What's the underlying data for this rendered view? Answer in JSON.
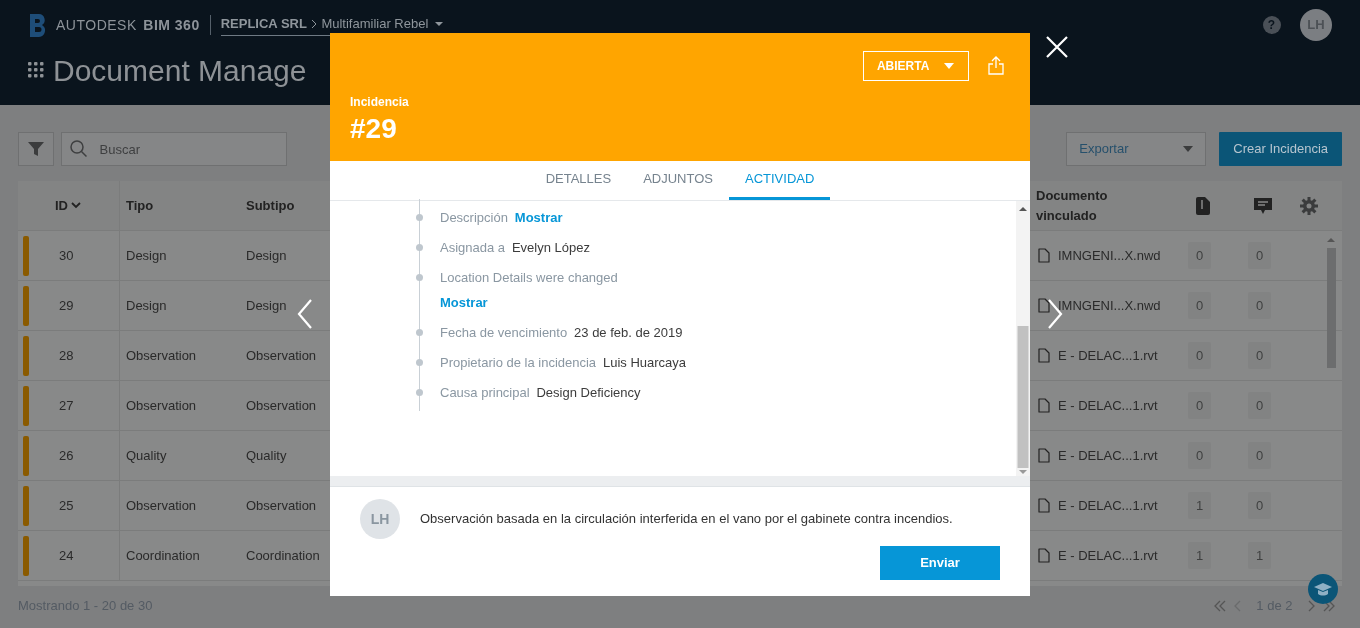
{
  "header": {
    "brand": "AUTODESK",
    "product": "BIM 360",
    "account": "REPLICA SRL",
    "project": "Multifamiliar Rebel",
    "help": "?",
    "avatar": "LH"
  },
  "page_title": "Document Manage",
  "toolbar": {
    "search": {
      "placeholder": "Buscar"
    },
    "export": "Exportar",
    "create": "Crear Incidencia"
  },
  "table": {
    "columns": [
      {
        "label": "ID",
        "kind": "id"
      },
      {
        "label": "Tipo",
        "kind": "text"
      },
      {
        "label": "Subtipo",
        "kind": "text"
      },
      {
        "label": "Documento vinculado",
        "kind": "text"
      },
      {
        "kind": "attachments"
      },
      {
        "kind": "comments"
      },
      {
        "kind": "settings"
      }
    ],
    "rows": [
      {
        "id": "30",
        "tipo": "Design",
        "subtipo": "Design",
        "document": "IMNGENI...X.nwd",
        "attachments": "0",
        "comments": "0"
      },
      {
        "id": "29",
        "tipo": "Design",
        "subtipo": "Design",
        "document": "IMNGENI...X.nwd",
        "attachments": "0",
        "comments": "0"
      },
      {
        "id": "28",
        "tipo": "Observation",
        "subtipo": "Observation",
        "document": "E - DELAC...1.rvt",
        "attachments": "0",
        "comments": "0"
      },
      {
        "id": "27",
        "tipo": "Observation",
        "subtipo": "Observation",
        "document": "E - DELAC...1.rvt",
        "attachments": "0",
        "comments": "0"
      },
      {
        "id": "26",
        "tipo": "Quality",
        "subtipo": "Quality",
        "document": "E - DELAC...1.rvt",
        "attachments": "0",
        "comments": "0"
      },
      {
        "id": "25",
        "tipo": "Observation",
        "subtipo": "Observation",
        "document": "E - DELAC...1.rvt",
        "attachments": "1",
        "comments": "0"
      },
      {
        "id": "24",
        "tipo": "Coordination",
        "subtipo": "Coordination",
        "document": "E - DELAC...1.rvt",
        "attachments": "1",
        "comments": "1"
      }
    ]
  },
  "footer": {
    "showing": "Mostrando 1 - 20 de 30",
    "page": "1 de 2"
  },
  "modal": {
    "status": "ABIERTA",
    "label": "Incidencia",
    "number": "#29",
    "tabs": [
      {
        "label": "DETALLES",
        "selected": false
      },
      {
        "label": "ADJUNTOS",
        "selected": false
      },
      {
        "label": "ACTIVIDAD",
        "selected": true
      }
    ],
    "activity": [
      {
        "label": "Descripción",
        "value": "Mostrar",
        "kind": "link"
      },
      {
        "label": "Asignada a",
        "value": "Evelyn López",
        "kind": "text"
      },
      {
        "label": "Location Details were changed",
        "value": "Mostrar",
        "kind": "link-below"
      },
      {
        "label": "Fecha de vencimiento",
        "value": "23 de feb. de 2019",
        "kind": "text"
      },
      {
        "label": "Propietario de la incidencia",
        "value": "Luis Huarcaya",
        "kind": "text"
      },
      {
        "label": "Causa principal",
        "value": "Design Deficiency",
        "kind": "text"
      }
    ],
    "comment": {
      "avatar": "LH",
      "value": "Observación basada en la circulación interferida en el vano por el gabinete contra incendios."
    },
    "send": "Enviar"
  }
}
